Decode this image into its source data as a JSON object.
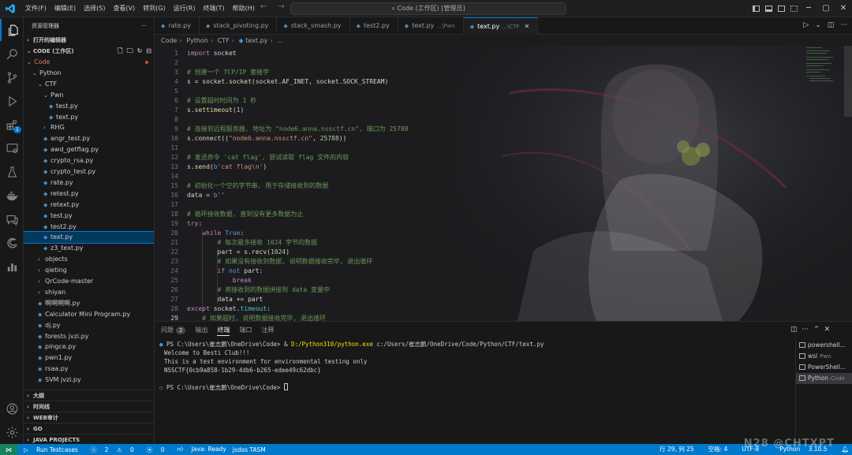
{
  "titlebar": {
    "menus": [
      "文件(F)",
      "编辑(E)",
      "选择(S)",
      "查看(V)",
      "转到(G)",
      "运行(R)",
      "终端(T)",
      "帮助(H)"
    ],
    "search": "Code (工作区) [管理员]"
  },
  "activity": {
    "extensions_badge": "1"
  },
  "sidebar": {
    "title": "资源管理器",
    "open_editors": "打开的编辑器",
    "workspace": "CODE (工作区)",
    "tree": [
      {
        "label": "Code",
        "kind": "folder-open",
        "level": 1,
        "root": true
      },
      {
        "label": "Python",
        "kind": "folder-open",
        "level": 2
      },
      {
        "label": "CTF",
        "kind": "folder-open",
        "level": 3
      },
      {
        "label": "Pwn",
        "kind": "folder-open",
        "level": 4
      },
      {
        "label": "test.py",
        "kind": "file",
        "level": 5
      },
      {
        "label": "text.py",
        "kind": "file",
        "level": 5
      },
      {
        "label": "RHG",
        "kind": "folder",
        "level": 4
      },
      {
        "label": "angr_test.py",
        "kind": "file",
        "level": 4
      },
      {
        "label": "awd_getflag.py",
        "kind": "file",
        "level": 4
      },
      {
        "label": "crypto_rsa.py",
        "kind": "file",
        "level": 4
      },
      {
        "label": "crypto_test.py",
        "kind": "file",
        "level": 4
      },
      {
        "label": "rate.py",
        "kind": "file",
        "level": 4
      },
      {
        "label": "retest.py",
        "kind": "file",
        "level": 4
      },
      {
        "label": "retext.py",
        "kind": "file",
        "level": 4
      },
      {
        "label": "test.py",
        "kind": "file",
        "level": 4
      },
      {
        "label": "test2.py",
        "kind": "file",
        "level": 4
      },
      {
        "label": "text.py",
        "kind": "file",
        "level": 4,
        "selected": true
      },
      {
        "label": "z3_text.py",
        "kind": "file",
        "level": 4
      },
      {
        "label": "objects",
        "kind": "folder",
        "level": 3
      },
      {
        "label": "qieting",
        "kind": "folder",
        "level": 3
      },
      {
        "label": "QrCode-master",
        "kind": "folder",
        "level": 3
      },
      {
        "label": "shiyan",
        "kind": "folder",
        "level": 3
      },
      {
        "label": "啊啊啊啊.py",
        "kind": "file",
        "level": 3
      },
      {
        "label": "Calculator Mini Program.py",
        "kind": "file",
        "level": 3
      },
      {
        "label": "dj.py",
        "kind": "file",
        "level": 3
      },
      {
        "label": "forests jvzi.py",
        "kind": "file",
        "level": 3
      },
      {
        "label": "pingce.py",
        "kind": "file",
        "level": 3
      },
      {
        "label": "pwn1.py",
        "kind": "file",
        "level": 3
      },
      {
        "label": "rsaa.py",
        "kind": "file",
        "level": 3
      },
      {
        "label": "SVM jvzi.py",
        "kind": "file",
        "level": 3
      }
    ],
    "sections": [
      "大纲",
      "时间线",
      "WEB审计",
      "GO",
      "JAVA PROJECTS"
    ]
  },
  "tabs": [
    {
      "name": "rate.py",
      "desc": ""
    },
    {
      "name": "stack_pivoting.py",
      "desc": ""
    },
    {
      "name": "stack_smash.py",
      "desc": ""
    },
    {
      "name": "test2.py",
      "desc": ""
    },
    {
      "name": "text.py",
      "desc": "...\\Pwn"
    },
    {
      "name": "text.py",
      "desc": "...\\CTF",
      "active": true
    }
  ],
  "breadcrumb": [
    "Code",
    "Python",
    "CTF",
    "text.py",
    "..."
  ],
  "code_lines": [
    [
      [
        "k",
        "import"
      ],
      [
        "p",
        " socket"
      ]
    ],
    [],
    [
      [
        "c",
        "# 创建一个 TCP/IP 套接字"
      ]
    ],
    [
      [
        "p",
        "s = socket."
      ],
      [
        "f",
        "socket"
      ],
      [
        "p",
        "(socket.AF_INET, socket.SOCK_STREAM)"
      ]
    ],
    [],
    [
      [
        "c",
        "# 设置超时时间为 1 秒"
      ]
    ],
    [
      [
        "p",
        "s."
      ],
      [
        "f",
        "settimeout"
      ],
      [
        "p",
        "("
      ],
      [
        "n",
        "1"
      ],
      [
        "p",
        ")"
      ]
    ],
    [],
    [
      [
        "c",
        "# 连接到远程服务器, 地址为 \"node6.anna.nssctf.cn\", 端口为 25788"
      ]
    ],
    [
      [
        "p",
        "s."
      ],
      [
        "f",
        "connect"
      ],
      [
        "p",
        "(("
      ],
      [
        "s",
        "\"node6.anna.nssctf.cn\""
      ],
      [
        "p",
        ", "
      ],
      [
        "n",
        "25788"
      ],
      [
        "p",
        "))"
      ]
    ],
    [],
    [
      [
        "c",
        "# 发送命令 'cat flag', 尝试读取 flag 文件的内容"
      ]
    ],
    [
      [
        "p",
        "s."
      ],
      [
        "f",
        "send"
      ],
      [
        "p",
        "("
      ],
      [
        "kb",
        "b"
      ],
      [
        "s",
        "'cat flag\\n'"
      ],
      [
        "p",
        ")"
      ]
    ],
    [],
    [
      [
        "c",
        "# 初始化一个空的字节串, 用于存储接收到的数据"
      ]
    ],
    [
      [
        "p",
        "data = "
      ],
      [
        "kb",
        "b"
      ],
      [
        "s",
        "''"
      ]
    ],
    [],
    [
      [
        "c",
        "# 循环接收数据, 直到没有更多数据为止"
      ]
    ],
    [
      [
        "k",
        "try"
      ],
      [
        "p",
        ":"
      ]
    ],
    [
      [
        "p",
        "    "
      ],
      [
        "k",
        "while"
      ],
      [
        "p",
        " "
      ],
      [
        "kb",
        "True"
      ],
      [
        "p",
        ":"
      ]
    ],
    [
      [
        "p",
        "        "
      ],
      [
        "c",
        "# 每次最多接收 1024 字节的数据"
      ]
    ],
    [
      [
        "p",
        "        part = s."
      ],
      [
        "f",
        "recv"
      ],
      [
        "p",
        "("
      ],
      [
        "n",
        "1024"
      ],
      [
        "p",
        ")"
      ]
    ],
    [
      [
        "p",
        "        "
      ],
      [
        "c",
        "# 如果没有接收到数据, 说明数据接收完毕, 退出循环"
      ]
    ],
    [
      [
        "p",
        "        "
      ],
      [
        "k",
        "if"
      ],
      [
        "p",
        " "
      ],
      [
        "kb",
        "not"
      ],
      [
        "p",
        " part:"
      ]
    ],
    [
      [
        "p",
        "            "
      ],
      [
        "k",
        "break"
      ]
    ],
    [
      [
        "p",
        "        "
      ],
      [
        "c",
        "# 将接收到的数据拼接到 data 变量中"
      ]
    ],
    [
      [
        "p",
        "        data += part"
      ]
    ],
    [
      [
        "k",
        "except"
      ],
      [
        "p",
        " socket."
      ],
      [
        "t",
        "timeout"
      ],
      [
        "p",
        ":"
      ]
    ],
    [
      [
        "p",
        "    "
      ],
      [
        "c",
        "# 如果超时, 说明数据接收完毕, 退出循环"
      ]
    ]
  ],
  "current_line": 29,
  "panel": {
    "tabs": [
      "问题",
      "输出",
      "终端",
      "端口",
      "注释"
    ],
    "problems_count": "2",
    "active_tab": "终端",
    "terminal": {
      "prompt": "PS C:\\Users\\崔志鹏\\OneDrive\\Code> ",
      "cmd_amp": "& ",
      "cmd_exe": "D:/Python310/python.exe",
      "cmd_arg": " c:/Users/崔志鹏/OneDrive/Code/Python/CTF/text.py",
      "out": [
        "Welcome to Besti Club!!!",
        "This is a test environment for environmental testing only",
        "NSSCTF{0cb9a858-1b29-4db6-b265-edee49c62dbc}"
      ],
      "prompt2": "PS C:\\Users\\崔志鹏\\OneDrive\\Code> "
    },
    "terminals": [
      {
        "name": "powershell...",
        "desc": ""
      },
      {
        "name": "wsl",
        "desc": "Pwn"
      },
      {
        "name": "PowerShell...",
        "desc": ""
      },
      {
        "name": "Python",
        "desc": "Code",
        "active": true
      }
    ]
  },
  "statusbar": {
    "run": "Run Testcases",
    "errors": "2",
    "warnings": "0",
    "ports": "0",
    "java": "Java: Ready",
    "jsdos": "jsdos TASM",
    "position": "行 29, 列 25",
    "spaces": "空格: 4",
    "encoding": "UTF-8",
    "language": "Python",
    "version": "3.10.5"
  },
  "watermark": "N28 @CHTXPT"
}
